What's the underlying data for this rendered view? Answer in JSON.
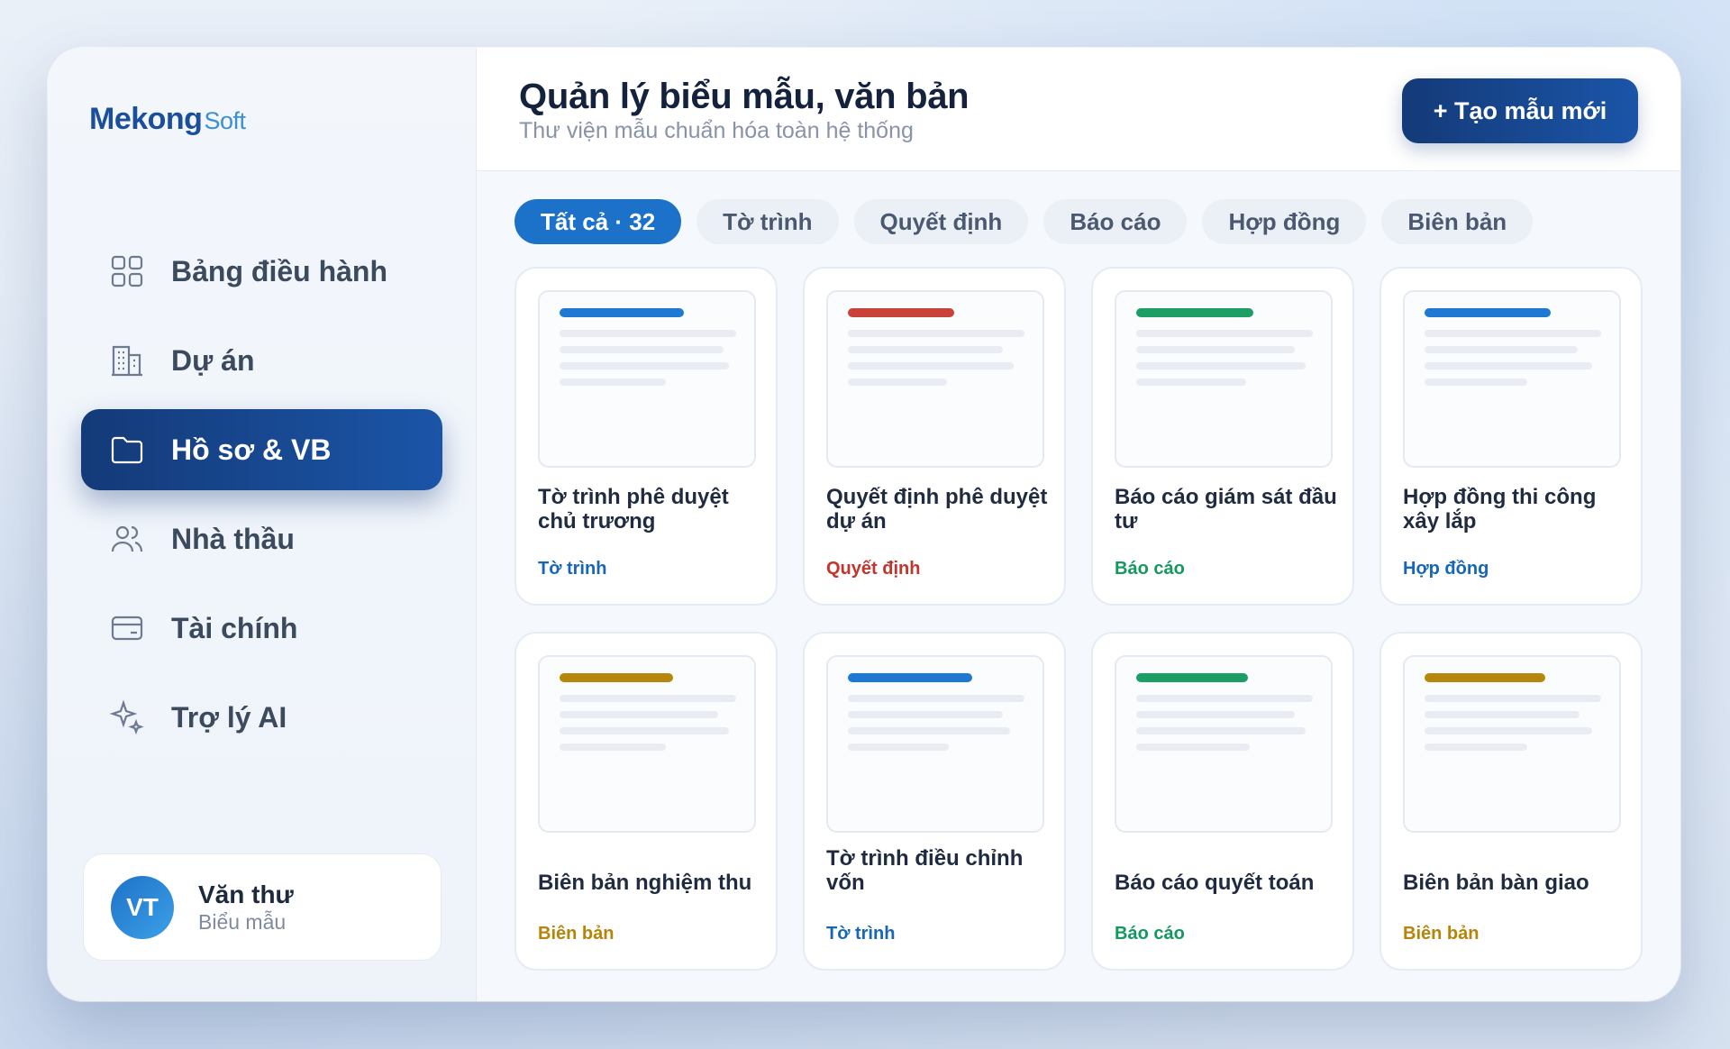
{
  "logo": {
    "main": "Mekong",
    "suffix": "Soft"
  },
  "sidebar": {
    "items": [
      {
        "label": "Bảng điều hành",
        "icon": "dashboard-grid-icon",
        "active": false
      },
      {
        "label": "Dự án",
        "icon": "building-icon",
        "active": false
      },
      {
        "label": "Hồ sơ & VB",
        "icon": "folder-icon",
        "active": true
      },
      {
        "label": "Nhà thầu",
        "icon": "users-icon",
        "active": false
      },
      {
        "label": "Tài chính",
        "icon": "card-icon",
        "active": false
      },
      {
        "label": "Trợ lý AI",
        "icon": "sparkle-icon",
        "active": false
      }
    ]
  },
  "user": {
    "initials": "VT",
    "name": "Văn thư",
    "role": "Biểu mẫu"
  },
  "header": {
    "title": "Quản lý biểu mẫu, văn bản",
    "subtitle": "Thư viện mẫu chuẩn hóa toàn hệ thống",
    "create_label": "+ Tạo mẫu mới"
  },
  "tabs": [
    {
      "label": "Tất cả · 32",
      "active": true
    },
    {
      "label": "Tờ trình",
      "active": false
    },
    {
      "label": "Quyết định",
      "active": false
    },
    {
      "label": "Báo cáo",
      "active": false
    },
    {
      "label": "Hợp đồng",
      "active": false
    },
    {
      "label": "Biên bản",
      "active": false
    }
  ],
  "colors": {
    "to_trinh": "#1f78d1",
    "quyet_dinh": "#c8423a",
    "bao_cao": "#1c9e65",
    "hop_dong": "#1f78d1",
    "bien_ban": "#b8860b",
    "tag_to_trinh": "#1766b8",
    "tag_quyet_dinh": "#c2342c",
    "tag_bao_cao": "#14985e",
    "tag_hop_dong": "#1766b8",
    "tag_bien_ban": "#b5840a"
  },
  "cards": [
    {
      "title": "Tờ trình phê duyệt chủ trương",
      "tag": "Tờ trình",
      "type": "to_trinh"
    },
    {
      "title": "Quyết định phê duyệt dự án",
      "tag": "Quyết định",
      "type": "quyet_dinh"
    },
    {
      "title": "Báo cáo giám sát đầu tư",
      "tag": "Báo cáo",
      "type": "bao_cao"
    },
    {
      "title": "Hợp đồng thi công xây lắp",
      "tag": "Hợp đồng",
      "type": "hop_dong"
    },
    {
      "title": "Biên bản nghiệm thu",
      "tag": "Biên bản",
      "type": "bien_ban"
    },
    {
      "title": "Tờ trình điều chỉnh vốn",
      "tag": "Tờ trình",
      "type": "to_trinh"
    },
    {
      "title": "Báo cáo quyết toán",
      "tag": "Báo cáo",
      "type": "bao_cao"
    },
    {
      "title": "Biên bản bàn giao",
      "tag": "Biên bản",
      "type": "bien_ban"
    }
  ]
}
